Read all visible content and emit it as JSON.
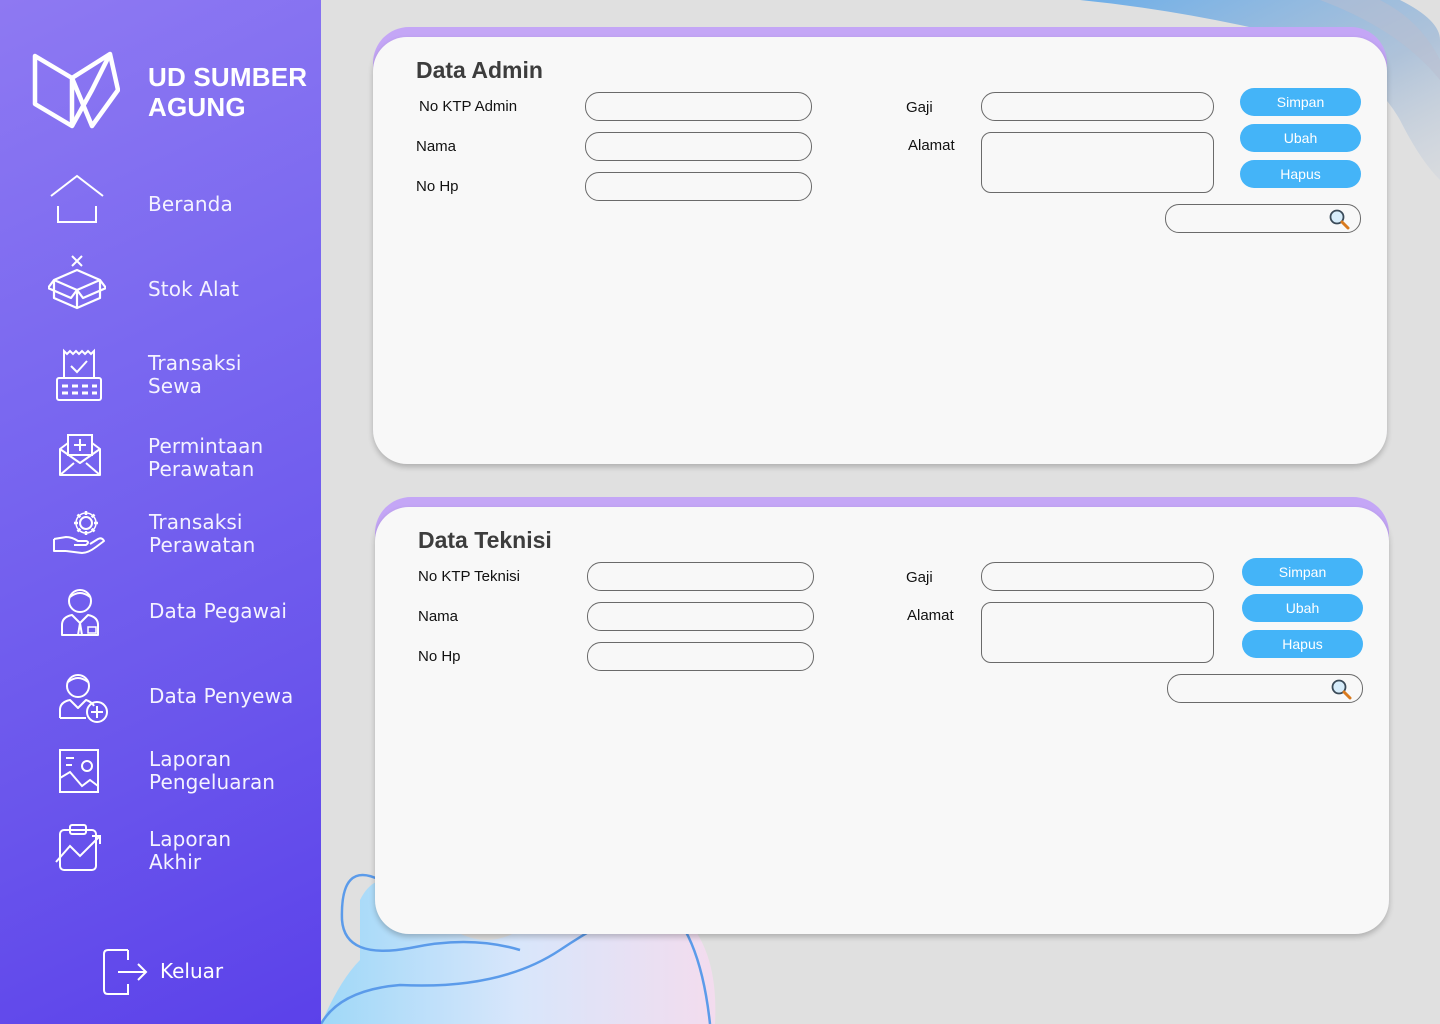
{
  "brand": {
    "name_line1": "UD SUMBER",
    "name_line2": "AGUNG"
  },
  "sidebar": {
    "items": [
      {
        "label_line1": "Beranda",
        "label_line2": "",
        "icon": "home-icon"
      },
      {
        "label_line1": "Stok Alat",
        "label_line2": "",
        "icon": "box-icon"
      },
      {
        "label_line1": "Transaksi",
        "label_line2": "Sewa",
        "icon": "cash-register-icon"
      },
      {
        "label_line1": "Permintaan",
        "label_line2": "Perawatan",
        "icon": "envelope-plus-icon"
      },
      {
        "label_line1": "Transaksi",
        "label_line2": "Perawatan",
        "icon": "gear-hand-icon"
      },
      {
        "label_line1": "Data Pegawai",
        "label_line2": "",
        "icon": "employee-icon"
      },
      {
        "label_line1": "Data Penyewa",
        "label_line2": "",
        "icon": "add-user-icon"
      },
      {
        "label_line1": "Laporan",
        "label_line2": "Pengeluaran",
        "icon": "report-image-icon"
      },
      {
        "label_line1": "Laporan",
        "label_line2": "Akhir",
        "icon": "clipboard-chart-icon"
      }
    ],
    "logout_label": "Keluar"
  },
  "admin_form": {
    "title": "Data Admin",
    "fields": {
      "ktp_label": "No KTP Admin",
      "ktp_value": "",
      "nama_label": "Nama",
      "nama_value": "",
      "hp_label": "No Hp",
      "hp_value": "",
      "gaji_label": "Gaji",
      "gaji_value": "",
      "alamat_label": "Alamat",
      "alamat_value": ""
    },
    "buttons": {
      "save": "Simpan",
      "edit": "Ubah",
      "delete": "Hapus"
    },
    "search": {
      "value": "",
      "placeholder": ""
    }
  },
  "teknisi_form": {
    "title": "Data Teknisi",
    "fields": {
      "ktp_label": "No KTP Teknisi",
      "ktp_value": "",
      "nama_label": "Nama",
      "nama_value": "",
      "hp_label": "No Hp",
      "hp_value": "",
      "gaji_label": "Gaji",
      "gaji_value": "",
      "alamat_label": "Alamat",
      "alamat_value": ""
    },
    "buttons": {
      "save": "Simpan",
      "edit": "Ubah",
      "delete": "Hapus"
    },
    "search": {
      "value": "",
      "placeholder": ""
    }
  },
  "colors": {
    "sidebar_gradient_top": "#8e79f2",
    "sidebar_gradient_bottom": "#5b41ea",
    "card_header_accent": "#c4a6f6",
    "button_primary": "#44b4f8",
    "page_background": "#e0e0e0",
    "card_background": "#f8f8f8"
  }
}
